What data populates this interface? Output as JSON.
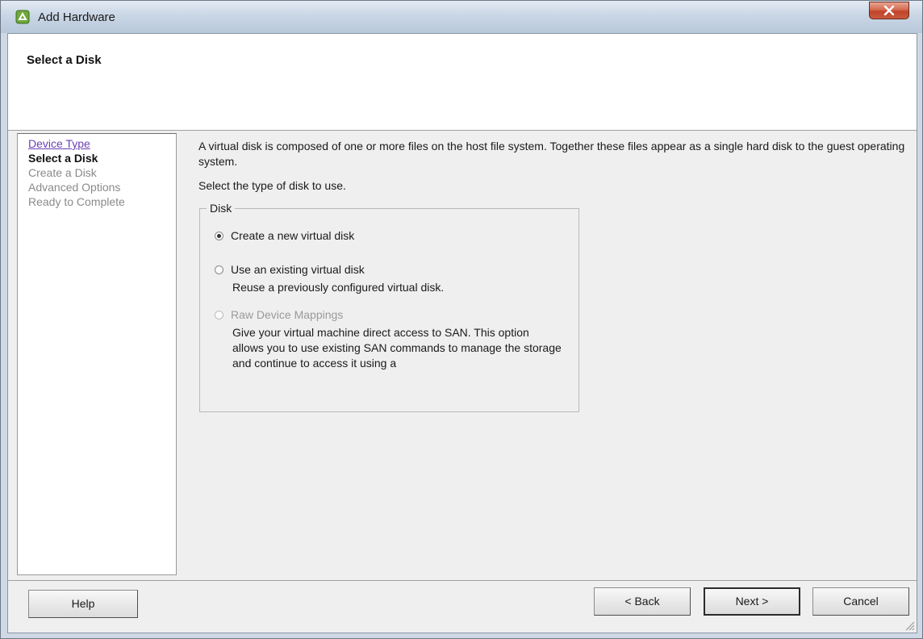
{
  "window": {
    "title": "Add Hardware"
  },
  "header": {
    "title": "Select a Disk"
  },
  "steps": {
    "device_type": "Device Type",
    "select_disk": "Select a Disk",
    "create_disk": "Create a Disk",
    "advanced_options": "Advanced Options",
    "ready": "Ready to Complete"
  },
  "content": {
    "intro": "A virtual disk is composed of one or more files on the host file system. Together these files appear as a single hard disk to the guest operating system.",
    "prompt": "Select the type of disk to use.",
    "group_label": "Disk",
    "options": [
      {
        "label": "Create a new virtual disk",
        "checked": true,
        "enabled": true
      },
      {
        "label": "Use an existing virtual disk",
        "checked": false,
        "enabled": true,
        "description": "Reuse a previously configured virtual disk."
      },
      {
        "label": "Raw Device Mappings",
        "checked": false,
        "enabled": false,
        "description": "Give your virtual machine direct access to SAN. This option allows you to use existing SAN commands to manage the storage and continue to access it using a"
      }
    ]
  },
  "buttons": {
    "help": "Help",
    "back": "< Back",
    "next": "Next >",
    "cancel": "Cancel"
  },
  "icons": {
    "app": "vsphere-icon",
    "close": "close-icon",
    "resize": "resize-grip-icon"
  },
  "colors": {
    "step_link": "#6c3fb4",
    "close_red": "#c95a3f"
  }
}
